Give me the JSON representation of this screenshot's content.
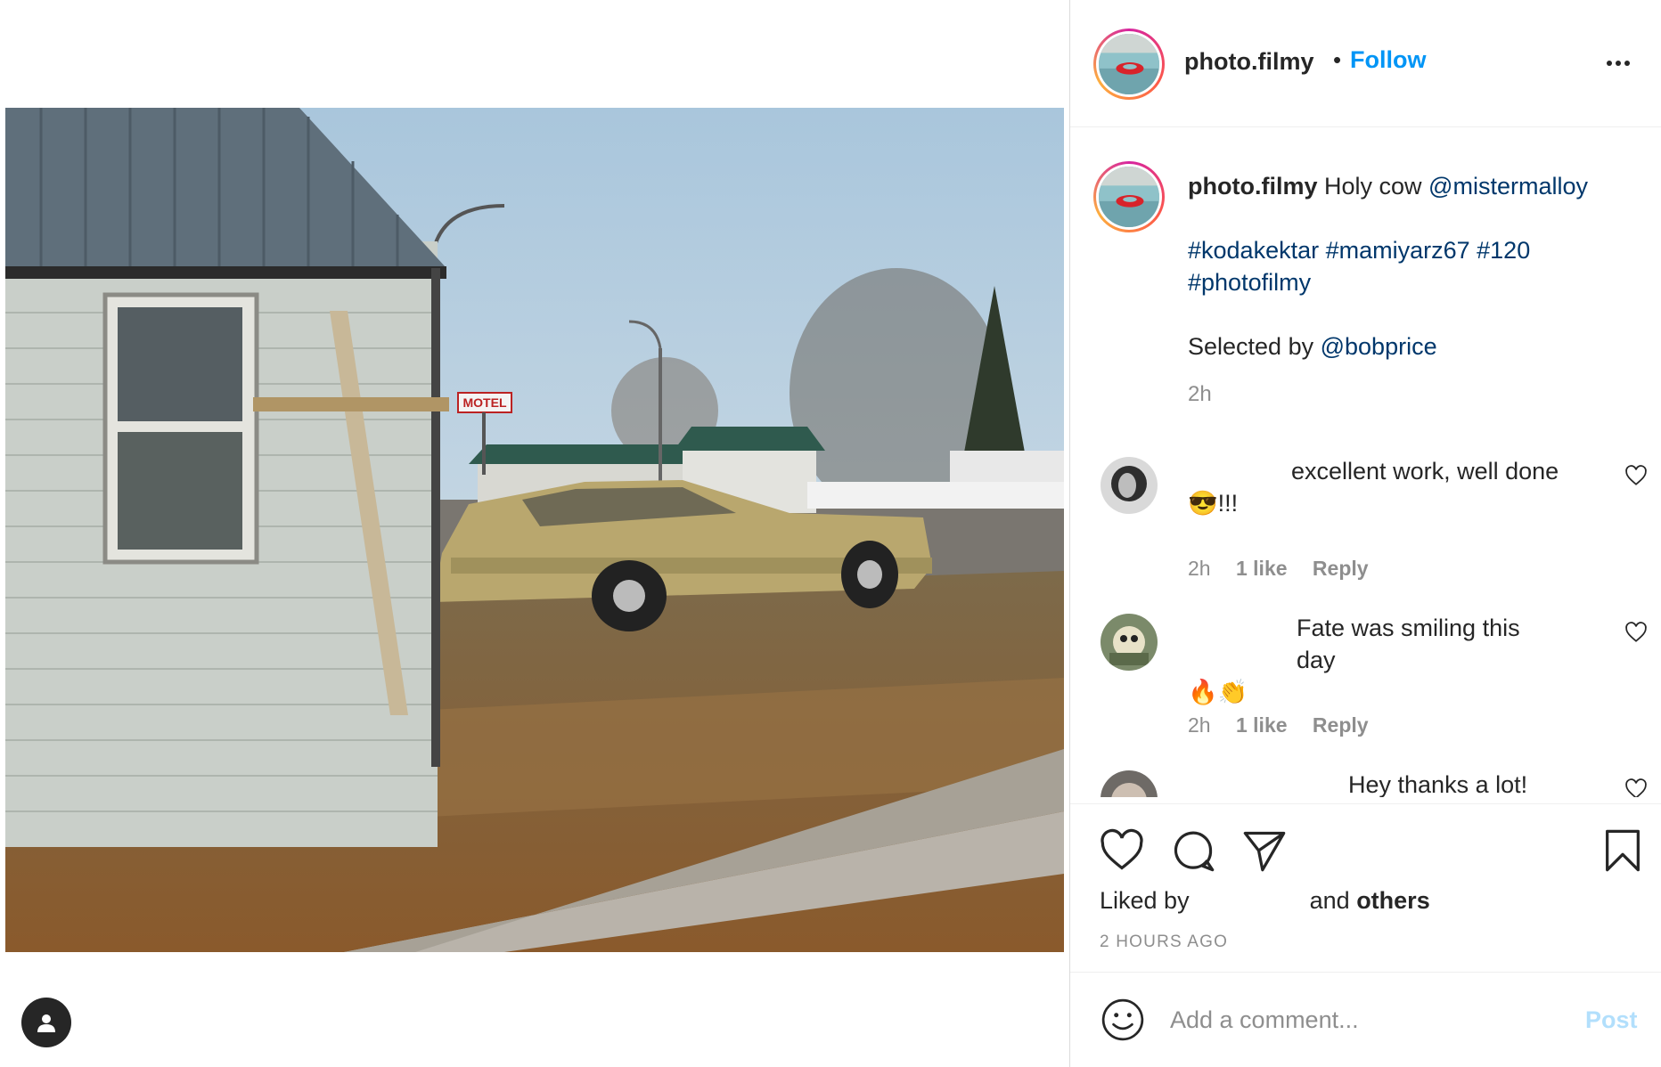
{
  "header": {
    "username": "photo.filmy",
    "separator": "•",
    "follow_label": "Follow"
  },
  "caption": {
    "username": "photo.filmy",
    "text": "Holy cow",
    "mention": "@mistermalloy",
    "hashtags_line1": "#kodakektar #mamiyarz67 #120",
    "hashtags_line2": "#photofilmy",
    "selected_prefix": "Selected by",
    "selected_mention": "@bobprice",
    "time": "2h"
  },
  "comments": [
    {
      "text": "excellent work, well done",
      "emoji_line": "😎!!!",
      "time": "2h",
      "likes": "1 like",
      "reply": "Reply"
    },
    {
      "text": "Fate was smiling this day",
      "emoji_line": "🔥👏",
      "time": "2h",
      "likes": "1 like",
      "reply": "Reply"
    },
    {
      "text": "Hey thanks a lot!"
    }
  ],
  "actions": {
    "liked_prefix": "Liked by",
    "liked_suffix_and": "and",
    "liked_suffix_others": "others",
    "time_ago": "2 HOURS AGO"
  },
  "add_comment": {
    "placeholder": "Add a comment...",
    "post_label": "Post"
  },
  "colors": {
    "accent": "#0095f6",
    "link": "#00376b",
    "muted": "#8e8e8e",
    "post_disabled": "#b2dffc"
  }
}
